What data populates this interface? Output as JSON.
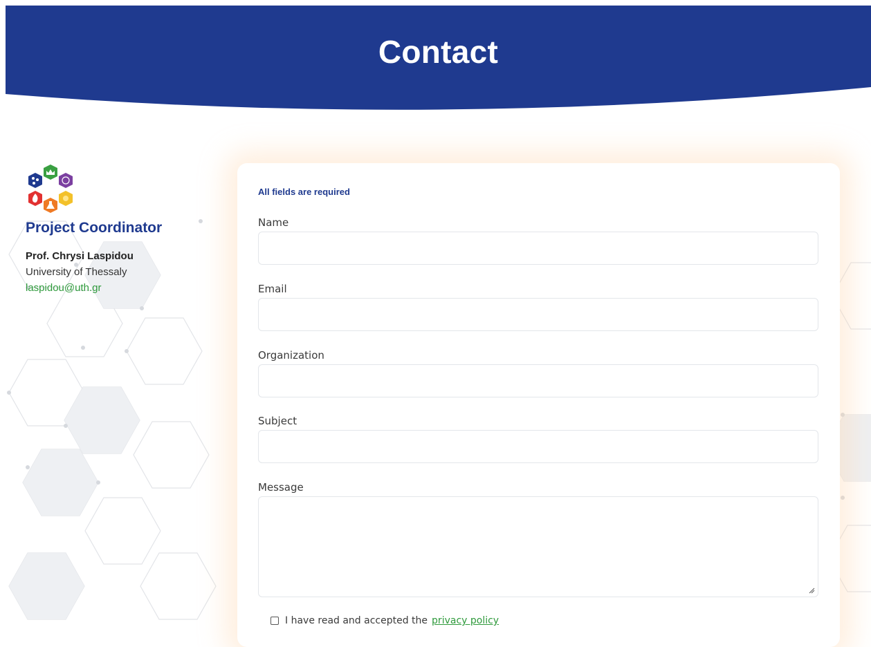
{
  "header": {
    "title": "Contact",
    "color": "#1f3a8f"
  },
  "coordinator": {
    "title": "Project Coordinator",
    "name": "Prof. Chrysi Laspidou",
    "organization": "University of Thessaly",
    "email": "laspidou@uth.gr"
  },
  "form": {
    "required_note": "All fields are required",
    "fields": {
      "name": {
        "label": "Name",
        "value": ""
      },
      "email": {
        "label": "Email",
        "value": ""
      },
      "organization": {
        "label": "Organization",
        "value": ""
      },
      "subject": {
        "label": "Subject",
        "value": ""
      },
      "message": {
        "label": "Message",
        "value": ""
      }
    },
    "consent": {
      "text": "I have read and accepted the",
      "link_text": "privacy policy",
      "checked": false
    }
  },
  "colors": {
    "brand_blue": "#1f3a8f",
    "link_green": "#2f9a3c"
  },
  "logo_icons": [
    "crown-icon",
    "globe-icon",
    "sun-icon",
    "flask-icon",
    "flame-icon",
    "molecule-icon"
  ]
}
